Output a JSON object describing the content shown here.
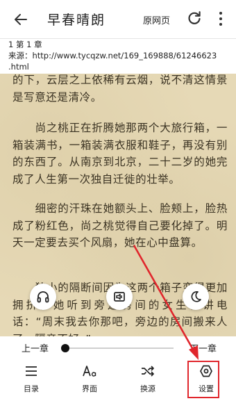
{
  "header": {
    "back_icon": "arrow-left-icon",
    "title": "早春晴朗",
    "origin_label": "原网页",
    "refresh_icon": "refresh-icon",
    "more_icon": "more-vertical-icon"
  },
  "chapter_info": {
    "chapter": "1 第 1 章",
    "source_line1": "来源：http://www.tycqzw.net/169_169888/61246623",
    "source_line2": ".html"
  },
  "content": {
    "paragraphs": [
      "的下，云层之上依稀有云烟，说不清这情景是写意还是清冷。",
      "　　尚之桃正在折腾她那两个大旅行箱，一箱装满书，一箱装满衣服和鞋子，再没有别的东西了。从南京到北京，二十二岁的她完成了人生第一次独自迁徙的壮举。",
      "　　细密的汗珠在她额头上、脸颊上，脸热成了粉红色，尚之桃觉得自己要化掉了。明天一定要去买个风扇，她在心中盘算。",
      "　　狭小的隔断间因为这两个箱子变得更加拥挤，她听到旁边房间的女生在讲电话：“周末我去你那吧，旁边的房间搬来人了，隔音不好。”"
    ]
  },
  "floating_buttons": {
    "audio_icon": "headphones-icon",
    "aloud_icon": "read-aloud-icon",
    "night_icon": "moon-icon"
  },
  "bottom": {
    "prev_label": "上一章",
    "next_label": "下一章",
    "progress": 0.0,
    "nav": [
      {
        "label": "目录",
        "icon": "list-icon"
      },
      {
        "label": "界面",
        "icon": "font-icon"
      },
      {
        "label": "换源",
        "icon": "shuffle-icon"
      },
      {
        "label": "设置",
        "icon": "settings-icon"
      }
    ]
  },
  "annotation": {
    "highlight_color": "#e0262c"
  }
}
